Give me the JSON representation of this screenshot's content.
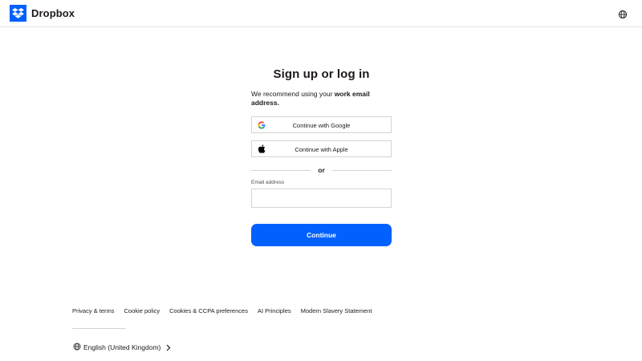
{
  "header": {
    "brand": "Dropbox",
    "logo_icon": "dropbox-logo-icon",
    "language_icon": "globe-icon"
  },
  "main": {
    "title": "Sign up or log in",
    "recommend_prefix": "We recommend using your ",
    "recommend_bold": "work email address.",
    "google_button": {
      "label": "Continue with Google",
      "icon": "google-icon"
    },
    "apple_button": {
      "label": "Continue with Apple",
      "icon": "apple-icon"
    },
    "divider_text": "or",
    "email_label": "Email address",
    "email_value": "",
    "email_placeholder": "",
    "continue_button": "Continue"
  },
  "footer": {
    "links": [
      "Privacy & terms",
      "Cookie policy",
      "Cookies & CCPA preferences",
      "AI Principles",
      "Modern Slavery Statement"
    ],
    "language": "English (United Kingdom)",
    "language_icon": "globe-icon",
    "language_chevron": "chevron-right-icon"
  },
  "colors": {
    "accent": "#0061fe",
    "text": "#1e1919",
    "border": "#d6d3cf"
  }
}
